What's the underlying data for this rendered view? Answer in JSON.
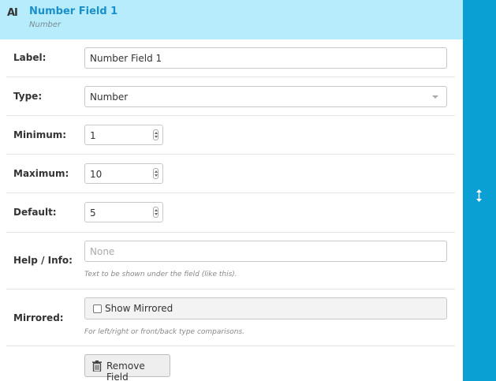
{
  "header": {
    "icon": "text-field-icon",
    "icon_text": "AI",
    "title": "Number Field 1",
    "subtitle": "Number"
  },
  "form": {
    "label": {
      "label": "Label:",
      "value": "Number Field 1"
    },
    "type": {
      "label": "Type:",
      "value": "Number"
    },
    "minimum": {
      "label": "Minimum:",
      "value": "1"
    },
    "maximum": {
      "label": "Maximum:",
      "value": "10"
    },
    "default": {
      "label": "Default:",
      "value": "5"
    },
    "help": {
      "label": "Help / Info:",
      "placeholder": "None",
      "hint": "Text to be shown under the field (like this)."
    },
    "mirrored": {
      "label": "Mirrored:",
      "checkbox_label": "Show Mirrored",
      "checked": false,
      "hint": "For left/right or front/back type comparisons."
    }
  },
  "actions": {
    "remove_label": "Remove Field",
    "remove_icon": "trash-icon"
  },
  "sidebar": {
    "icon": "resize-vertical-icon"
  },
  "colors": {
    "header_bg": "#b6ecfb",
    "title": "#1a8fc8",
    "sidebar_bg": "#0aa0d4"
  }
}
